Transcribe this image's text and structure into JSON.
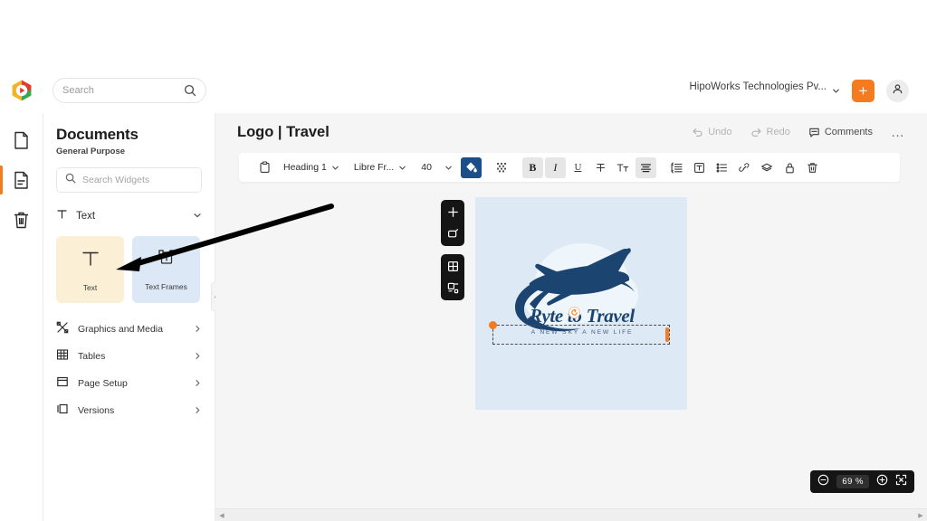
{
  "app": {
    "brand_icon": "hexagon-play-logo",
    "brand_colors": {
      "red": "#e03b2e",
      "yellow": "#f0b429",
      "green": "#34a853"
    },
    "accent": "#f47b20",
    "toolbar_accent": "#1b4f8a"
  },
  "topbar": {
    "search": {
      "placeholder": "Search",
      "value": "",
      "icon": "search-icon"
    },
    "org": {
      "name": "HipoWorks Technologies Pv...",
      "chevron": "chevron-down-icon"
    },
    "add_button": {
      "label": "+",
      "icon": "plus-icon"
    },
    "account_button": {
      "icon": "user-icon"
    }
  },
  "rail": {
    "items": [
      {
        "name": "blank-document",
        "icon": "document-icon",
        "active": false
      },
      {
        "name": "document-with-text",
        "icon": "document-lines-icon",
        "active": true
      },
      {
        "name": "trash",
        "icon": "trash-icon",
        "active": false
      }
    ]
  },
  "panel": {
    "title": "Documents",
    "subtitle": "General Purpose",
    "search": {
      "placeholder": "Search Widgets",
      "value": "",
      "icon": "search-icon"
    },
    "group": {
      "label": "Text",
      "icon": "text-t-icon",
      "chevron": "chevron-down-icon"
    },
    "cards": [
      {
        "label": "Text",
        "icon": "text-t-icon",
        "bg": "#fbefd5",
        "selected": true
      },
      {
        "label": "Text Frames",
        "icon": "text-frame-icon",
        "bg": "#dce8f5",
        "selected": false
      }
    ],
    "nav": [
      {
        "label": "Graphics and Media",
        "icon": "graphics-media-icon",
        "chevron": "chevron-right-icon"
      },
      {
        "label": "Tables",
        "icon": "table-grid-icon",
        "chevron": "chevron-right-icon"
      },
      {
        "label": "Page Setup",
        "icon": "page-setup-icon",
        "chevron": "chevron-right-icon"
      },
      {
        "label": "Versions",
        "icon": "versions-icon",
        "chevron": "chevron-right-icon"
      }
    ],
    "collapse": {
      "icon": "chevron-left-icon"
    }
  },
  "document": {
    "title": "Logo | Travel",
    "header_actions": [
      {
        "label": "Undo",
        "icon": "undo-arrow-icon",
        "enabled": false
      },
      {
        "label": "Redo",
        "icon": "redo-arrow-icon",
        "enabled": false
      },
      {
        "label": "Comments",
        "icon": "comment-bubble-icon",
        "enabled": true
      }
    ],
    "more_menu": "…"
  },
  "toolbar": {
    "clipboard": {
      "icon": "clipboard-icon"
    },
    "style": {
      "value": "Heading 1",
      "chevron": "chevron-down-icon"
    },
    "font": {
      "value": "Libre Fr...",
      "chevron": "chevron-down-icon"
    },
    "size": {
      "value": "40",
      "chevron": "chevron-down-icon"
    },
    "items": [
      {
        "name": "fill-color",
        "icon": "paint-bucket-icon",
        "state": "accent"
      },
      {
        "name": "pattern-fill",
        "icon": "checker-pattern-icon",
        "state": "off"
      },
      {
        "name": "bold",
        "icon": "bold-b-icon",
        "state": "active",
        "glyph": "B"
      },
      {
        "name": "italic",
        "icon": "italic-i-icon",
        "state": "active",
        "glyph": "I"
      },
      {
        "name": "underline",
        "icon": "underline-u-icon",
        "state": "off",
        "glyph": "U"
      },
      {
        "name": "strikethrough",
        "icon": "strikethrough-icon",
        "state": "off"
      },
      {
        "name": "text-case",
        "icon": "text-case-icon",
        "state": "off"
      },
      {
        "name": "align",
        "icon": "align-center-icon",
        "state": "active"
      },
      {
        "name": "line-spacing",
        "icon": "line-spacing-icon",
        "state": "off"
      },
      {
        "name": "text-box",
        "icon": "text-box-icon",
        "state": "off"
      },
      {
        "name": "bullet-list",
        "icon": "bullet-list-icon",
        "state": "off"
      },
      {
        "name": "link",
        "icon": "link-chain-icon",
        "state": "off"
      },
      {
        "name": "layers",
        "icon": "layers-icon",
        "state": "off"
      },
      {
        "name": "lock",
        "icon": "lock-icon",
        "state": "off"
      },
      {
        "name": "delete",
        "icon": "trash-icon",
        "state": "off"
      }
    ]
  },
  "canvas": {
    "background": "#dde9f5",
    "logo": {
      "name": "ryte-to-travel-logo",
      "brand_text": "Ryte to Travel",
      "tagline": "A NEW SKY A NEW LIFE",
      "plane_color": "#1b4470",
      "cloud_color": "#eef5fb",
      "icon": "airplane-swoosh-icon"
    },
    "selection": {
      "active": true,
      "handle_color": "#f47b20",
      "rotate_icon": "rotate-handle-icon"
    }
  },
  "float_tools": {
    "groups": [
      {
        "items": [
          {
            "name": "add",
            "icon": "plus-icon"
          },
          {
            "name": "shape",
            "icon": "shape-square-icon"
          }
        ]
      },
      {
        "items": [
          {
            "name": "grid",
            "icon": "grid-icon"
          },
          {
            "name": "layout",
            "icon": "layout-icon"
          }
        ]
      }
    ]
  },
  "zoom_control": {
    "minus": "minus-circle-icon",
    "level": "69",
    "unit": "%",
    "plus": "plus-circle-icon",
    "fullscreen": "fullscreen-icon"
  },
  "scrollbar": {
    "left_arrow": "chevron-left-icon",
    "right_arrow": "chevron-right-icon"
  },
  "annotation": {
    "type": "pointer-arrow",
    "color": "#000000",
    "points_to": "Text widget card"
  }
}
